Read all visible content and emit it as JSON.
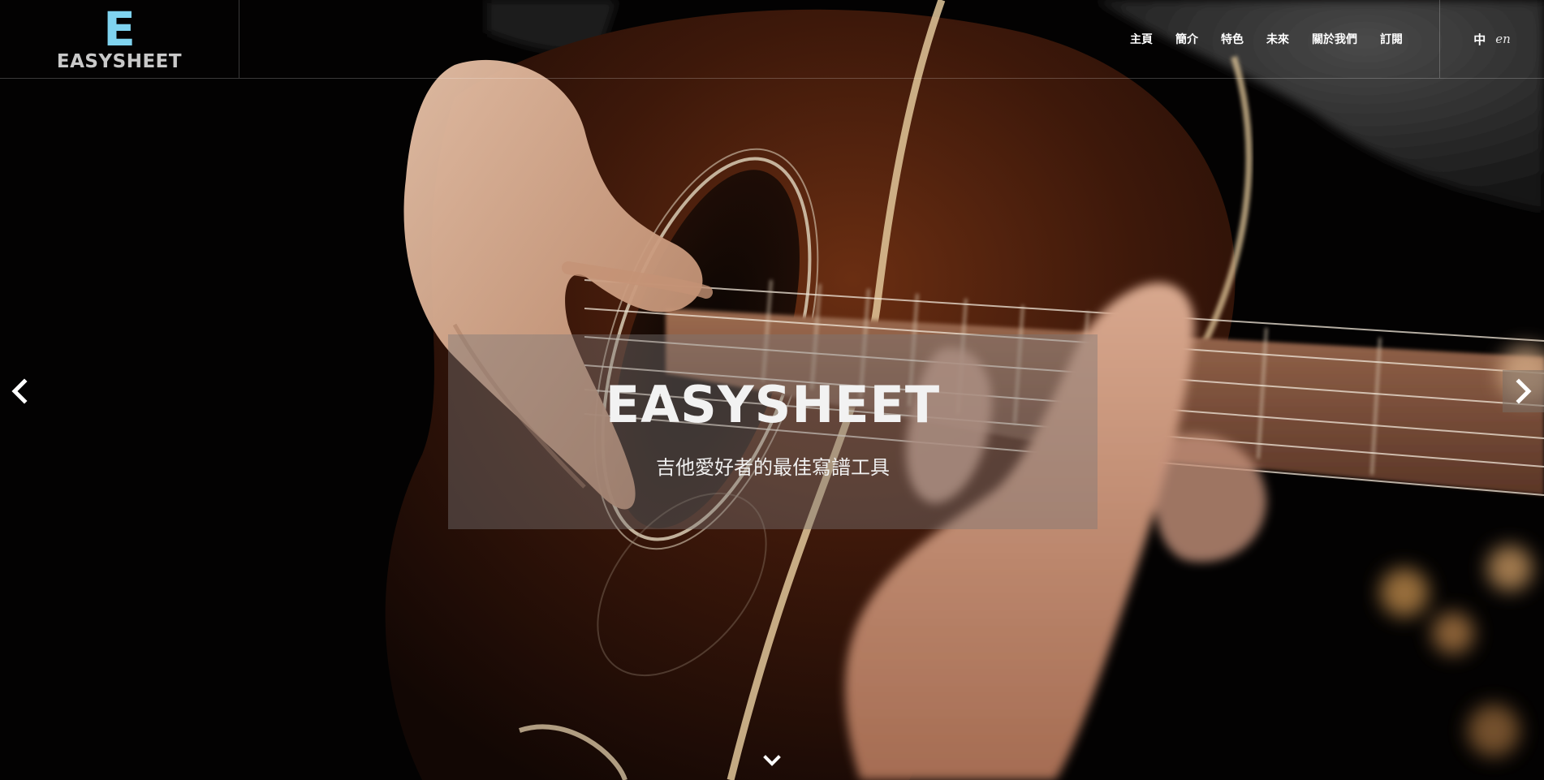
{
  "header": {
    "logo_mark": "E",
    "logo_text": "EASYSHEET",
    "nav": [
      {
        "label": "主頁"
      },
      {
        "label": "簡介"
      },
      {
        "label": "特色"
      },
      {
        "label": "未來"
      },
      {
        "label": "關於我們"
      },
      {
        "label": "訂閱"
      }
    ],
    "lang": {
      "zh": "中",
      "en": "en"
    }
  },
  "hero": {
    "title": "EASYSHEET",
    "subtitle": "吉他愛好者的最佳寫譜工具",
    "prev_icon": "chevron-left-icon",
    "next_icon": "chevron-right-icon",
    "scroll_icon": "chevron-down-icon"
  },
  "colors": {
    "logo_accent": "#7fd3ef",
    "caption_bg": "rgba(125,120,118,0.42)",
    "background": "#000000"
  }
}
